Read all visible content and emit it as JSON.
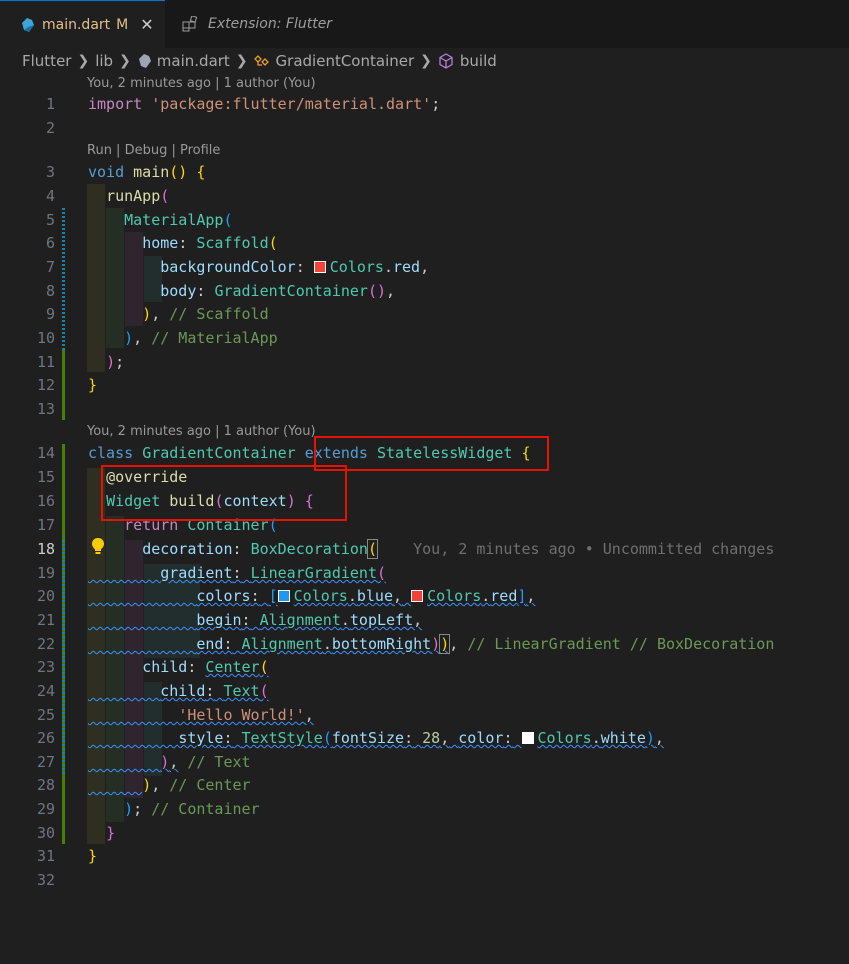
{
  "tabs": [
    {
      "title": "main.dart",
      "badge": "M",
      "close": "✕",
      "icon": "dart-icon",
      "active": true
    },
    {
      "title": "Extension: Flutter",
      "icon": "extension-icon",
      "active": false
    }
  ],
  "breadcrumb": [
    "Flutter",
    "lib",
    "main.dart",
    "GradientContainer",
    "build"
  ],
  "codelens": {
    "author1": "You, 2 minutes ago | 1 author (You)",
    "run": "Run | Debug | Profile",
    "author2": "You, 2 minutes ago | 1 author (You)"
  },
  "line_numbers": [
    "1",
    "2",
    "3",
    "4",
    "5",
    "6",
    "7",
    "8",
    "9",
    "10",
    "11",
    "12",
    "13",
    "14",
    "15",
    "16",
    "17",
    "18",
    "19",
    "20",
    "21",
    "22",
    "23",
    "24",
    "25",
    "26",
    "27",
    "28",
    "29",
    "30",
    "31",
    "32"
  ],
  "current_line": "18",
  "code": {
    "l1_import": "import",
    "l1_str": "'package:flutter/material.dart'",
    "l1_semi": ";",
    "l3_void": "void",
    "l3_main": "main",
    "l4_runApp": "runApp",
    "l5_materialApp": "MaterialApp",
    "l6_home": "home",
    "l6_scaffold": "Scaffold",
    "l7_bg": "backgroundColor",
    "l7_colors": "Colors",
    "l7_red": "red",
    "l8_body": "body",
    "l8_gc": "GradientContainer",
    "l9_comment": "// Scaffold",
    "l10_comment": "// MaterialApp",
    "l14_class": "class",
    "l14_name": "GradientContainer",
    "l14_extends": "extends",
    "l14_sw": "StatelessWidget",
    "l15_override": "@override",
    "l16_widget": "Widget",
    "l16_build": "build",
    "l16_ctx": "context",
    "l17_return": "return",
    "l17_container": "Container",
    "l18_decoration": "decoration",
    "l18_boxdec": "BoxDecoration",
    "l18_blame": "You, 2 minutes ago • Uncommitted changes",
    "l19_gradient": "gradient",
    "l19_lg": "LinearGradient",
    "l20_colors": "colors",
    "l20_c1": "Colors",
    "l20_blue": "blue",
    "l20_c2": "Colors",
    "l20_red": "red",
    "l21_begin": "begin",
    "l21_align": "Alignment",
    "l21_tl": "topLeft",
    "l22_end": "end",
    "l22_align": "Alignment",
    "l22_br": "bottomRight",
    "l22_comment": "// LinearGradient // BoxDecoration",
    "l23_child": "child",
    "l23_center": "Center",
    "l24_child": "child",
    "l24_text": "Text",
    "l25_str": "'Hello World!'",
    "l26_style": "style",
    "l26_ts": "TextStyle",
    "l26_fs": "fontSize",
    "l26_num": "28",
    "l26_color": "color",
    "l26_colors": "Colors",
    "l26_white": "white",
    "l27_comment": "// Text",
    "l28_comment": "// Center",
    "l29_comment": "// Container"
  },
  "colors": {
    "red_swatch": "#f44336",
    "blue_swatch": "#2196f3",
    "white_swatch": "#ffffff",
    "highlight_box": "#e51400"
  }
}
